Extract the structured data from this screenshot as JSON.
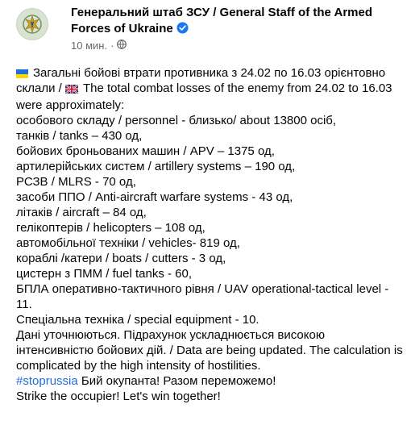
{
  "post": {
    "author": "Генеральний штаб ЗСУ / General Staff of the Armed Forces of Ukraine",
    "time": "10 мин.",
    "privacy_icon": "globe-icon",
    "verified_icon": "verified-badge-icon",
    "lines": [
      "Загальні бойові втрати противника з 24.02 по 16.03 орієнтовно",
      "склали /",
      "The total combat losses of the enemy from 24.02 to 16.03",
      "were approximately:",
      "особового складу / personnel - близько/ about 13800 осіб,",
      "танків / tanks – 430 од,",
      "бойових броньованих машин / APV  – 1375 од,",
      "артилерійських систем / artillery systems – 190 од,",
      "РСЗВ / MLRS - 70 од,",
      "засоби ППО / Anti-aircraft warfare systems - 43 од,",
      "літаків / aircraft – 84 од,",
      "гелікоптерів / helicopters – 108 од,",
      "автомобільної техніки / vehicles- 819 од,",
      "кораблі /катери / boats / cutters - 3 од,",
      "цистерн з ПММ / fuel tanks - 60,",
      "БПЛА оперативно-тактичного рівня / UAV operational-tactical level - 11.",
      "Спеціальна техніка / special equipment - 10.",
      "Дані уточнюються. Підрахунок ускладнюється високою інтенсивністю бойових дій. / Data are being updated. The calculation is complicated by the high intensity of hostilities.",
      "#stoprussia",
      "Бий окупанта! Разом переможемо!",
      "Strike the occupier! Let's win together!"
    ],
    "colors": {
      "text": "#050505",
      "secondary": "#65676b",
      "link": "#216fdb",
      "verified": "#1877f2"
    }
  }
}
